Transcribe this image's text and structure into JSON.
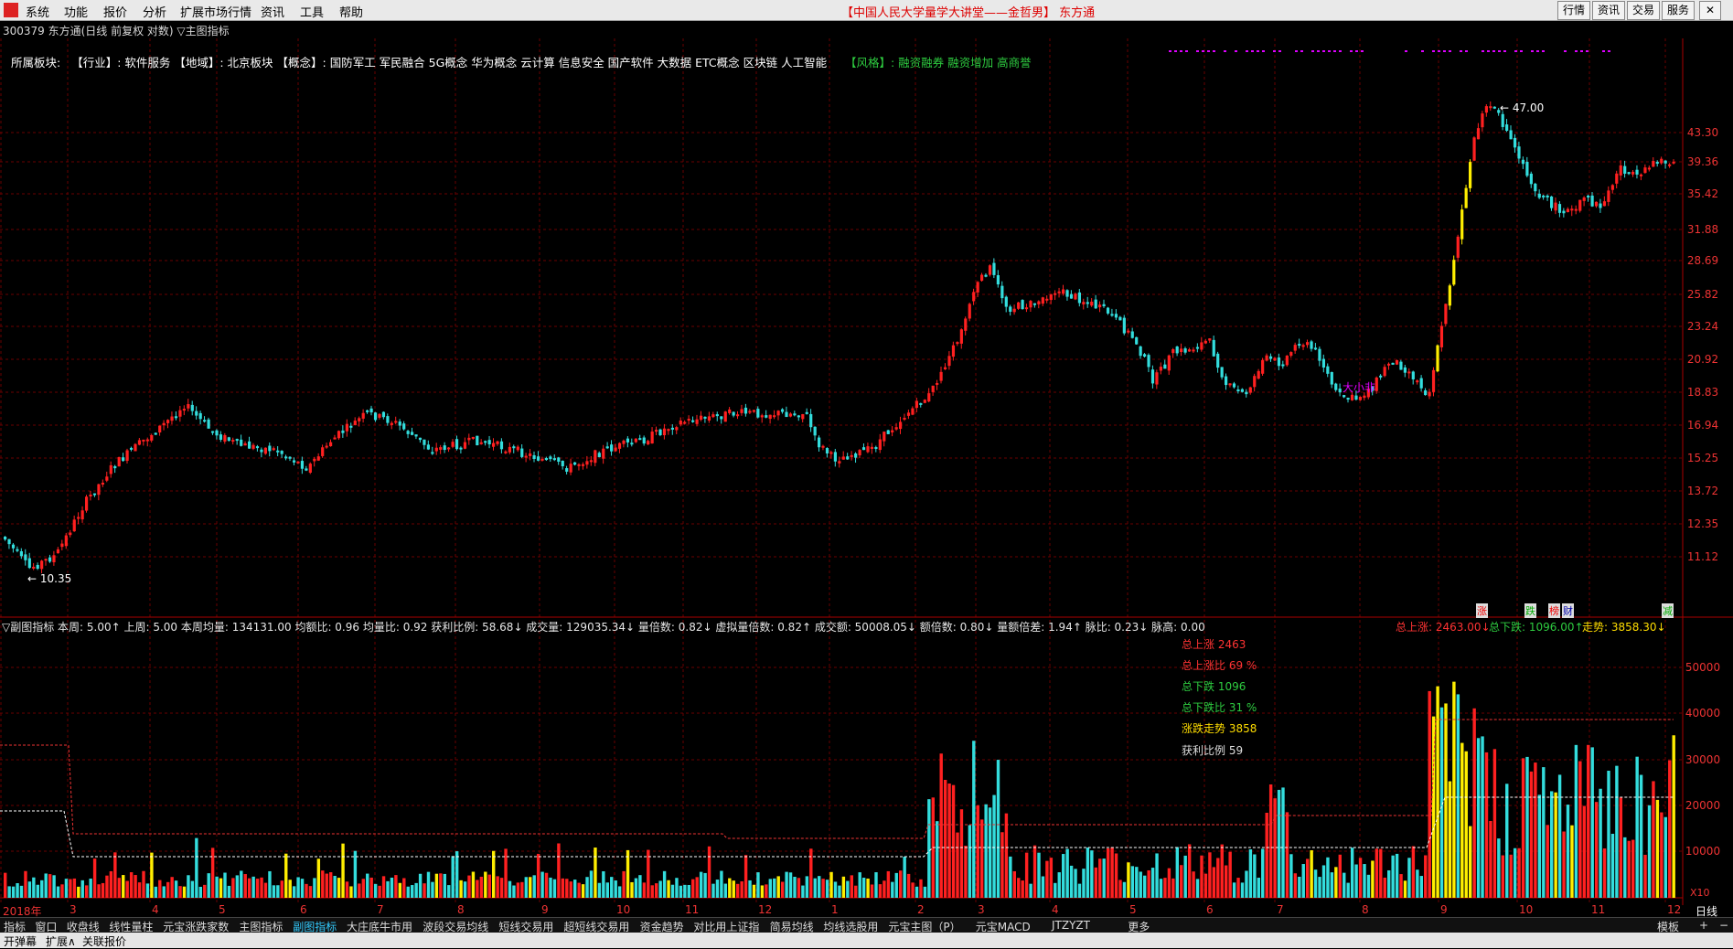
{
  "menubar": {
    "items": [
      "系统",
      "功能",
      "报价",
      "分析",
      "扩展市场行情",
      "资讯",
      "工具",
      "帮助"
    ],
    "center_title": "【中国人民大学量学大讲堂——金哲男】 东方通",
    "right_buttons": [
      "行情",
      "资讯",
      "交易",
      "服务"
    ]
  },
  "chart_title": "300379 东方通(日线 前复权 对数) ▽主图指标",
  "boards": {
    "label": "所属板块:",
    "text": "【行业】: 软件服务 【地域】: 北京板块 【概念】: 国防军工 军民融合 5G概念 华为概念 云计算 信息安全 国产软件 大数据 ETC概念 区块链 人工智能",
    "style": "【风格】: 融资融券 融资增加 高商誉"
  },
  "price_labels": [
    "43.30",
    "39.36",
    "35.42",
    "31.88",
    "28.69",
    "25.82",
    "23.24",
    "20.92",
    "18.83",
    "16.94",
    "15.25",
    "13.72",
    "12.35",
    "11.12"
  ],
  "marks": {
    "high": "47.00",
    "low": "10.35",
    "note": "大小非"
  },
  "sub_header": {
    "left": "▽副图指标 本周: 5.00↑ 上周: 5.00 本周均量: 134131.00 均额比: 0.96 均量比: 0.92 获利比例: 58.68↓ 成交量: 129035.34↓ 量倍数: 0.82↓ 虚拟量倍数: 0.82↑ 成交额: 50008.05↓ 额倍数: 0.80↓ 量额倍差: 1.94↑ 脉比: 0.23↓ 脉高: 0.00",
    "up": "总上涨: 2463.00↓",
    "down": "总下跌: 1096.00↑",
    "trend": "走势: 3858.30↓"
  },
  "stats": {
    "up": "总上涨 2463",
    "up_ratio": "总上涨比 69 %",
    "down": "总下跌 1096",
    "down_ratio": "总下跌比 31 %",
    "trend": "涨跌走势 3858",
    "profit": "获利比例 59"
  },
  "side_tags": [
    "涨",
    "跌",
    "榜",
    "财",
    "减"
  ],
  "vol_labels": [
    "50000",
    "40000",
    "30000",
    "20000",
    "10000"
  ],
  "vol_unit": "X10",
  "x_labels": [
    "2018年",
    "3",
    "4",
    "5",
    "6",
    "7",
    "8",
    "9",
    "10",
    "11",
    "12",
    "1",
    "2",
    "3",
    "4",
    "5",
    "6",
    "7",
    "8",
    "9",
    "10",
    "11",
    "12"
  ],
  "period": "日线",
  "tabs": [
    "指标",
    "窗口",
    "收盘线",
    "线性量柱",
    "元宝涨跌家数",
    "主图指标",
    "副图指标",
    "大庄底牛市用",
    "波段交易均线",
    "短线交易用",
    "超短线交易用",
    "资金趋势",
    "对比用上证指",
    "简易均线",
    "均线选股用",
    "元宝主图（P）",
    "元宝MACD",
    "JTZYZT",
    "更多"
  ],
  "active_tab": "副图指标",
  "tab_right": [
    "模板",
    "+",
    "−"
  ],
  "status": [
    "开弹幕",
    "扩展∧",
    "关联报价"
  ],
  "colors": {
    "up": "#ff2020",
    "down": "#33dddd",
    "limit": "#ffee00",
    "grid": "#6a0000",
    "volume_ma": "#ffffff"
  }
}
